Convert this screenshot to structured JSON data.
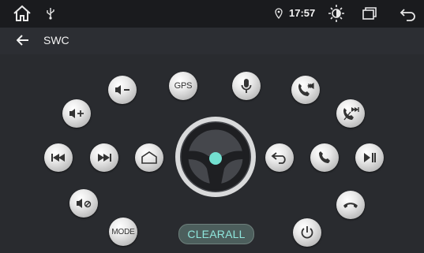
{
  "statusbar": {
    "time": "17:57",
    "icons": [
      "home-icon",
      "usb-icon",
      "location-icon",
      "brightness-icon",
      "recent-apps-icon",
      "back-icon"
    ]
  },
  "appbar": {
    "title": "SWC",
    "back_icon": "arrow-left-icon"
  },
  "buttons": {
    "gps_label": "GPS",
    "mode_label": "MODE",
    "clearall_label": "CLEARALL"
  },
  "colors": {
    "background": "#292b2f",
    "accent": "#73e0d0",
    "button": "#e6e6e6"
  }
}
